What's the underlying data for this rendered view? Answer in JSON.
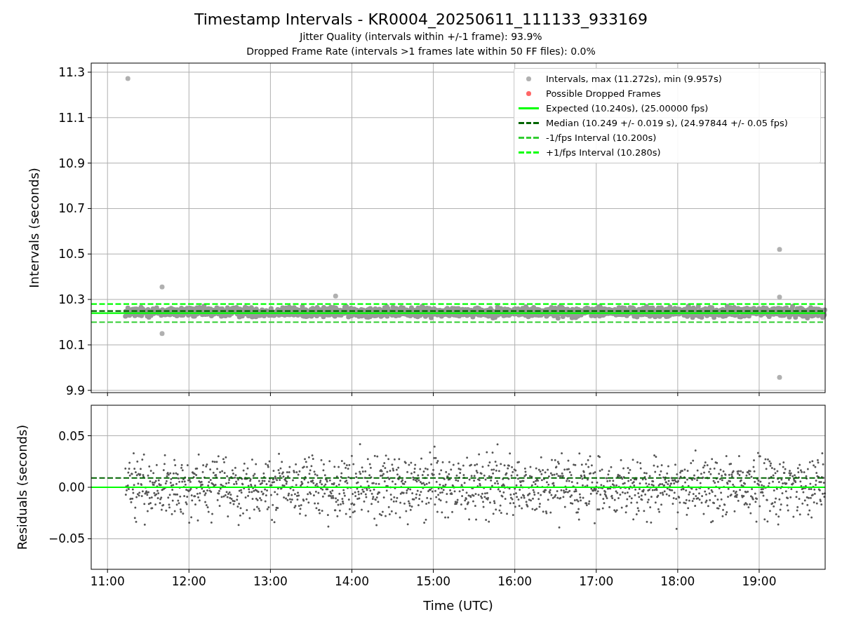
{
  "title": "Timestamp Intervals - KR0004_20250611_111133_933169",
  "subtitles": [
    "Jitter Quality (intervals within +/-1 frame): 93.9%",
    "Dropped Frame Rate (intervals >1 frames late within 50 FF files): 0.0%"
  ],
  "top_chart": {
    "chart_data": {
      "type": "scatter",
      "ylabel": "Intervals (seconds)",
      "xlim": [
        10.8,
        19.81
      ],
      "ylim": [
        9.89,
        11.34
      ],
      "grid": true,
      "yticks": [
        {
          "value": 9.9,
          "label": "9.9"
        },
        {
          "value": 10.1,
          "label": "10.1"
        },
        {
          "value": 10.3,
          "label": "10.3"
        },
        {
          "value": 10.5,
          "label": "10.5"
        },
        {
          "value": 10.7,
          "label": "10.7"
        },
        {
          "value": 10.9,
          "label": "10.9"
        },
        {
          "value": 11.1,
          "label": "11.1"
        },
        {
          "value": 11.3,
          "label": "11.3"
        }
      ],
      "series": [
        {
          "color": "#b0b0b0",
          "x": [
            11.25,
            11.67,
            11.67,
            19.25,
            19.25,
            19.25,
            13.8
          ],
          "values": [
            11.272,
            10.355,
            10.15,
            10.52,
            9.957,
            10.31,
            10.315
          ]
        }
      ],
      "ref_lines": [
        {
          "axis": "y",
          "value": 10.24,
          "color": "#00ff00"
        },
        {
          "axis": "y",
          "value": 10.249,
          "color": "#006400"
        },
        {
          "axis": "y",
          "value": 10.2,
          "color": "#32cd32"
        },
        {
          "axis": "y",
          "value": 10.28,
          "color": "#00ff00"
        }
      ]
    },
    "legend": [
      {
        "label": "Intervals, max (11.272s), min (9.957s)",
        "kind": "dot",
        "color": "#b0b0b0"
      },
      {
        "label": "Possible Dropped Frames",
        "kind": "dot",
        "color": "#ff6666"
      },
      {
        "label": "Expected (10.240s), (25.00000 fps)",
        "kind": "solid",
        "color": "#00ff00"
      },
      {
        "label": "Median (10.249 +/- 0.019 s), (24.97844 +/- 0.05 fps)",
        "kind": "dashed",
        "color": "#006400"
      },
      {
        "label": "-1/fps Interval (10.200s)",
        "kind": "dashed",
        "color": "#32cd32"
      },
      {
        "label": "+1/fps Interval (10.280s)",
        "kind": "dashed",
        "color": "#00ff00"
      }
    ]
  },
  "bottom_chart": {
    "chart_data": {
      "type": "scatter",
      "grid": true,
      "xlabel": "Time (UTC)",
      "ylabel": "Residuals (seconds)",
      "xlim": [
        10.8,
        19.81
      ],
      "ylim": [
        -0.0796,
        0.0796
      ],
      "xticks": [
        {
          "value": 11,
          "label": "11:00"
        },
        {
          "value": 12,
          "label": "12:00"
        },
        {
          "value": 13,
          "label": "13:00"
        },
        {
          "value": 14,
          "label": "14:00"
        },
        {
          "value": 15,
          "label": "15:00"
        },
        {
          "value": 16,
          "label": "16:00"
        },
        {
          "value": 17,
          "label": "17:00"
        },
        {
          "value": 18,
          "label": "18:00"
        },
        {
          "value": 19,
          "label": "19:00"
        }
      ],
      "yticks": [
        {
          "value": -0.05,
          "label": "−0.05"
        },
        {
          "value": 0,
          "label": "0.00"
        },
        {
          "value": 0.05,
          "label": "0.05"
        }
      ],
      "ref_lines": [
        {
          "axis": "y",
          "value": 0.009,
          "color": "#006400"
        },
        {
          "axis": "y",
          "value": 0,
          "color": "#00ff00"
        }
      ]
    }
  }
}
